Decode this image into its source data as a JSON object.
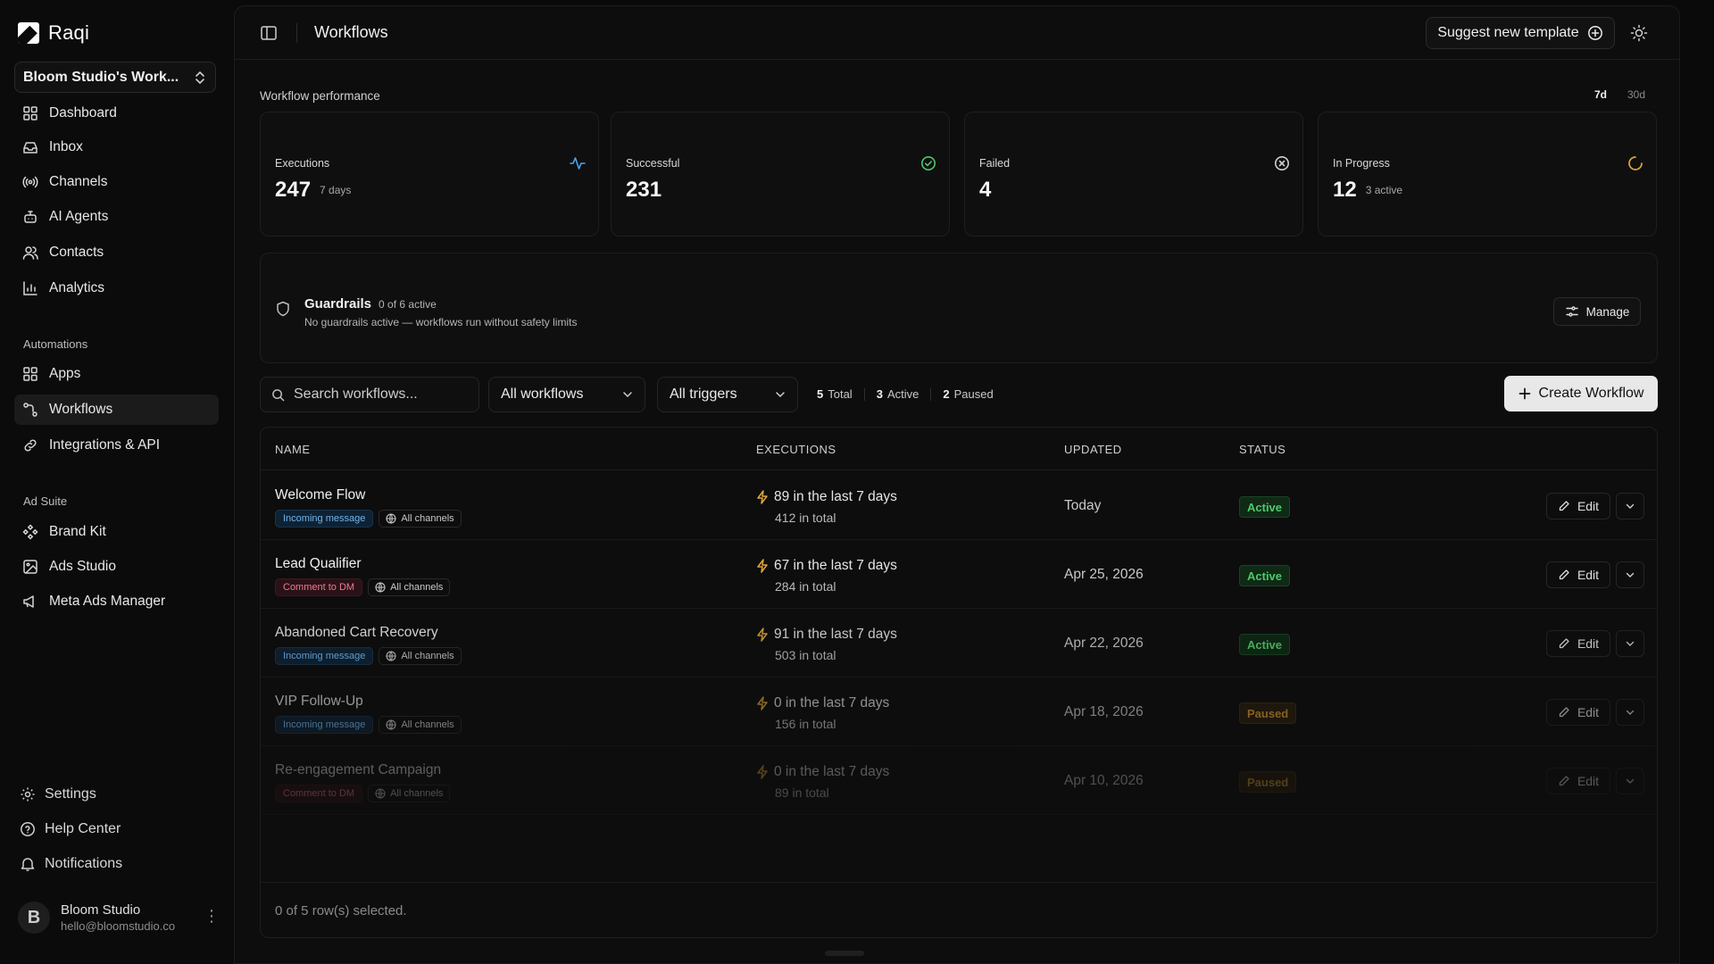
{
  "app": {
    "brand": "Raqi",
    "workspace": "Bloom Studio's Work..."
  },
  "sidebar": {
    "main": [
      {
        "label": "Dashboard",
        "icon": "dashboard-icon"
      },
      {
        "label": "Inbox",
        "icon": "inbox-icon"
      },
      {
        "label": "Channels",
        "icon": "broadcast-icon"
      },
      {
        "label": "AI Agents",
        "icon": "bot-icon"
      },
      {
        "label": "Contacts",
        "icon": "contacts-icon"
      },
      {
        "label": "Analytics",
        "icon": "chart-icon"
      }
    ],
    "automations_title": "Automations",
    "automations": [
      {
        "label": "Apps",
        "icon": "apps-icon"
      },
      {
        "label": "Workflows",
        "icon": "workflow-icon",
        "active": true
      },
      {
        "label": "Integrations & API",
        "icon": "link-icon"
      }
    ],
    "adsuite_title": "Ad Suite",
    "adsuite": [
      {
        "label": "Brand Kit",
        "icon": "brand-kit-icon"
      },
      {
        "label": "Ads Studio",
        "icon": "image-icon"
      },
      {
        "label": "Meta Ads Manager",
        "icon": "megaphone-icon"
      }
    ],
    "bottom": [
      {
        "label": "Settings",
        "icon": "gear-icon"
      },
      {
        "label": "Help Center",
        "icon": "help-icon"
      },
      {
        "label": "Notifications",
        "icon": "bell-icon"
      }
    ],
    "user": {
      "initial": "B",
      "name": "Bloom Studio",
      "email": "hello@bloomstudio.co"
    }
  },
  "header": {
    "title": "Workflows",
    "suggest_label": "Suggest new template"
  },
  "performance": {
    "title": "Workflow performance",
    "range_7d": "7d",
    "range_30d": "30d",
    "cards": [
      {
        "label": "Executions",
        "value": "247",
        "sub": "7 days",
        "icon": "activity-icon",
        "color": "#4aa3f0"
      },
      {
        "label": "Successful",
        "value": "231",
        "sub": "",
        "icon": "check-circle-icon",
        "color": "#4ec96b"
      },
      {
        "label": "Failed",
        "value": "4",
        "sub": "",
        "icon": "x-circle-icon",
        "color": "#cfcfcf"
      },
      {
        "label": "In Progress",
        "value": "12",
        "sub": "3 active",
        "icon": "loader-icon",
        "color": "#e0a63b"
      }
    ]
  },
  "guardrails": {
    "title": "Guardrails",
    "count": "0 of 6 active",
    "description": "No guardrails active — workflows run without safety limits",
    "manage_label": "Manage"
  },
  "filters": {
    "search_placeholder": "Search workflows...",
    "workflow_filter": "All workflows",
    "trigger_filter": "All triggers",
    "total_num": "5",
    "total_label": "Total",
    "active_num": "3",
    "active_label": "Active",
    "paused_num": "2",
    "paused_label": "Paused",
    "create_label": "Create Workflow"
  },
  "table": {
    "headers": {
      "name": "NAME",
      "executions": "EXECUTIONS",
      "updated": "UPDATED",
      "status": "STATUS"
    },
    "edit_label": "Edit",
    "rows": [
      {
        "name": "Welcome Flow",
        "trigger": "Incoming message",
        "trigger_type": "incoming",
        "channels": "All channels",
        "exec_recent": "89 in the last 7 days",
        "exec_total": "412 in total",
        "updated": "Today",
        "status": "Active"
      },
      {
        "name": "Lead Qualifier",
        "trigger": "Comment to DM",
        "trigger_type": "comment",
        "channels": "All channels",
        "exec_recent": "67 in the last 7 days",
        "exec_total": "284 in total",
        "updated": "Apr 25, 2026",
        "status": "Active"
      },
      {
        "name": "Abandoned Cart Recovery",
        "trigger": "Incoming message",
        "trigger_type": "incoming",
        "channels": "All channels",
        "exec_recent": "91 in the last 7 days",
        "exec_total": "503 in total",
        "updated": "Apr 22, 2026",
        "status": "Active"
      },
      {
        "name": "VIP Follow-Up",
        "trigger": "Incoming message",
        "trigger_type": "incoming",
        "channels": "All channels",
        "exec_recent": "0 in the last 7 days",
        "exec_total": "156 in total",
        "updated": "Apr 18, 2026",
        "status": "Paused"
      },
      {
        "name": "Re-engagement Campaign",
        "trigger": "Comment to DM",
        "trigger_type": "comment",
        "channels": "All channels",
        "exec_recent": "0 in the last 7 days",
        "exec_total": "89 in total",
        "updated": "Apr 10, 2026",
        "status": "Paused"
      }
    ],
    "footer": "0 of 5 row(s) selected."
  }
}
